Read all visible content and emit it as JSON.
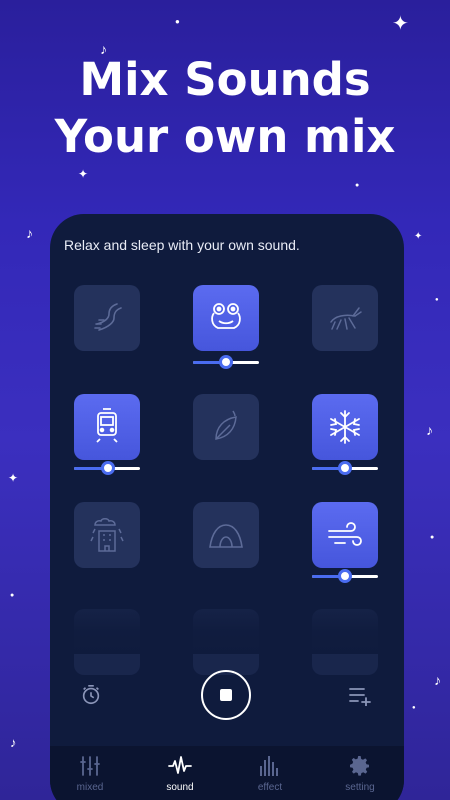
{
  "headline": {
    "line1": "Mix Sounds",
    "line2": "Your own mix"
  },
  "app": {
    "subtitle": "Relax and sleep with your own sound.",
    "sounds": [
      {
        "name": "river-icon",
        "active": false
      },
      {
        "name": "frog-icon",
        "active": true,
        "volume": 0.5
      },
      {
        "name": "grasshopper-icon",
        "active": false
      },
      {
        "name": "train-icon",
        "active": true,
        "volume": 0.5
      },
      {
        "name": "leaf-icon",
        "active": false
      },
      {
        "name": "snowflake-icon",
        "active": true,
        "volume": 0.5
      },
      {
        "name": "city-rain-icon",
        "active": false
      },
      {
        "name": "cave-icon",
        "active": false
      },
      {
        "name": "wind-icon",
        "active": true,
        "volume": 0.5
      }
    ],
    "controls": {
      "timer_icon": "timer-icon",
      "stop_icon": "stop-icon",
      "playlist_icon": "playlist-add-icon"
    },
    "nav": [
      {
        "label": "mixed",
        "icon": "sliders-icon",
        "active": false
      },
      {
        "label": "sound",
        "icon": "waveform-icon",
        "active": true
      },
      {
        "label": "effect",
        "icon": "equalizer-icon",
        "active": false
      },
      {
        "label": "setting",
        "icon": "gear-icon",
        "active": false
      }
    ]
  },
  "colors": {
    "background": "#3328b8",
    "panel": "#0f1b3d",
    "accent": "#5b6bf0",
    "tile": "#24325c"
  }
}
